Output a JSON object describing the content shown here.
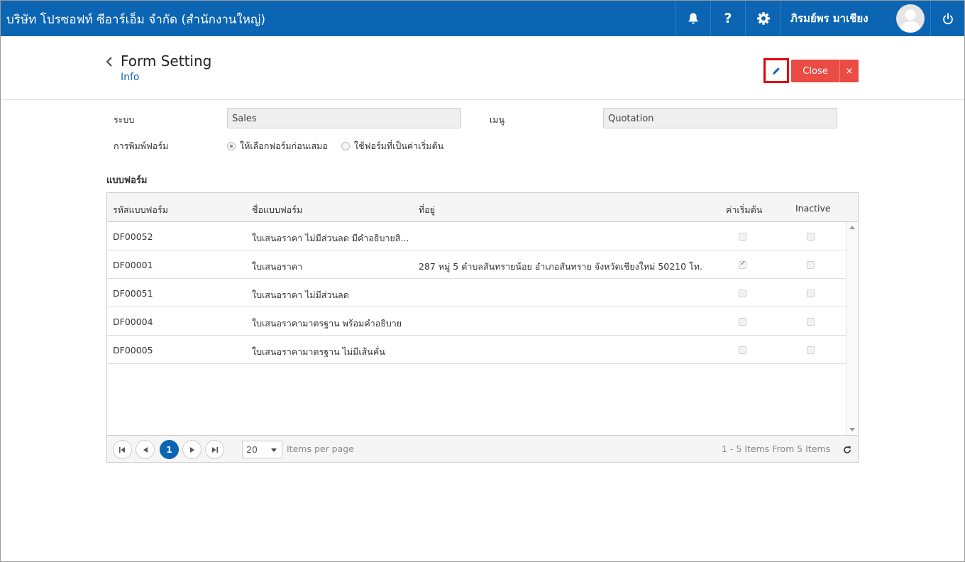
{
  "topbar": {
    "company": "บริษัท โปรซอฟท์ ซีอาร์เอ็ม จำกัด (สำนักงานใหญ่)",
    "user_name": "ภิรมย์พร มาเชียง",
    "icons": [
      "bell-icon",
      "question-icon",
      "gear-icon",
      "avatar",
      "power-icon"
    ]
  },
  "header": {
    "title": "Form Setting",
    "subtitle": "Info",
    "close_label": "Close",
    "close_x": "×"
  },
  "form": {
    "system_label": "ระบบ",
    "system_value": "Sales",
    "menu_label": "เมนู",
    "menu_value": "Quotation",
    "print_label": "การพิมพ์ฟอร์ม",
    "radio_options": [
      {
        "label": "ให้เลือกฟอร์มก่อนเสมอ",
        "selected": true
      },
      {
        "label": "ใช้ฟอร์มที่เป็นค่าเริ่มต้น",
        "selected": false
      }
    ]
  },
  "section": {
    "title": "แบบฟอร์ม"
  },
  "grid": {
    "columns": [
      "รหัสแบบฟอร์ม",
      "ชื่อแบบฟอร์ม",
      "ที่อยู่",
      "ค่าเริ่มต้น",
      "Inactive"
    ],
    "rows": [
      {
        "code": "DF00052",
        "name": "ใบเสนอราคา ไม่มีส่วนลด มีคำอธิบายสิ...",
        "address": "",
        "default": false,
        "inactive": false
      },
      {
        "code": "DF00001",
        "name": "ใบเสนอราคา",
        "address": "287 หมู่ 5 ตำบลสันทรายน้อย อำเภอสันทราย จังหวัดเชียงใหม่ 50210 โท...",
        "default": true,
        "inactive": false
      },
      {
        "code": "DF00051",
        "name": "ใบเสนอราคา ไม่มีส่วนลด",
        "address": "",
        "default": false,
        "inactive": false
      },
      {
        "code": "DF00004",
        "name": "ใบเสนอราคามาตรฐาน พร้อมคำอธิบาย",
        "address": "",
        "default": false,
        "inactive": false
      },
      {
        "code": "DF00005",
        "name": "ใบเสนอราคามาตรฐาน ไม่มีเส้นคั่น",
        "address": "",
        "default": false,
        "inactive": false
      }
    ]
  },
  "pager": {
    "current_page": "1",
    "page_size": "20",
    "items_per_page": "Items per page",
    "summary": "1 - 5 Items From 5 Items"
  },
  "colors": {
    "topbar": "#0b65b3",
    "close_button": "#ea4b43",
    "edit_highlight": "#e3000f",
    "link": "#1565c0"
  }
}
